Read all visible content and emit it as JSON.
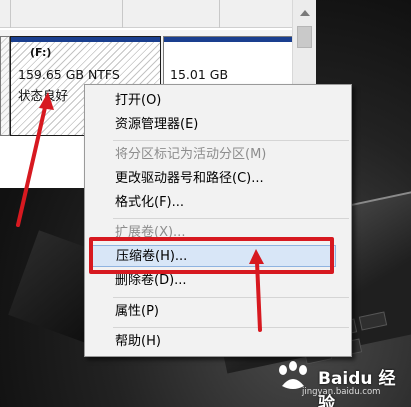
{
  "partitions": {
    "f": {
      "drive": "(F:)",
      "size": "159.65 GB NTFS",
      "status": "状态良好"
    },
    "next": {
      "size": "15.01 GB"
    }
  },
  "context_menu": {
    "items": [
      {
        "label": "打开(O)",
        "enabled": true
      },
      {
        "label": "资源管理器(E)",
        "enabled": true
      },
      {
        "label": "将分区标记为活动分区(M)",
        "enabled": false
      },
      {
        "label": "更改驱动器号和路径(C)...",
        "enabled": true
      },
      {
        "label": "格式化(F)...",
        "enabled": true
      },
      {
        "label": "扩展卷(X)...",
        "enabled": false
      },
      {
        "label": "压缩卷(H)...",
        "enabled": true,
        "highlighted": true
      },
      {
        "label": "删除卷(D)...",
        "enabled": true
      },
      {
        "label": "属性(P)",
        "enabled": true
      },
      {
        "label": "帮助(H)",
        "enabled": true
      }
    ]
  },
  "watermark": {
    "brand": "Baidu 经验",
    "url": "jingyan.baidu.com"
  },
  "colors": {
    "annotation_red": "#d71920",
    "menu_highlight": "#d8e6f7",
    "partition_stripe": "#1a3f8f"
  }
}
